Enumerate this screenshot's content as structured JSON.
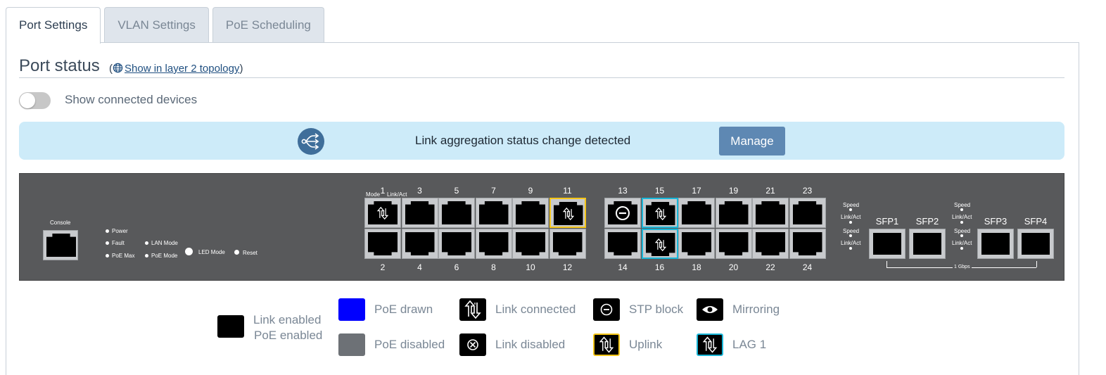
{
  "tabs": [
    {
      "label": "Port Settings",
      "active": true
    },
    {
      "label": "VLAN Settings",
      "active": false
    },
    {
      "label": "PoE Scheduling",
      "active": false
    }
  ],
  "port_status": {
    "title": "Port status",
    "topology_link": "Show in layer 2 topology",
    "topology_open": "(",
    "topology_close": ")"
  },
  "toggle": {
    "label": "Show connected devices",
    "on": false
  },
  "alert": {
    "message": "Link aggregation status change detected",
    "button": "Manage",
    "icon": "link-aggregation-icon"
  },
  "switch_panel": {
    "console_label": "Console",
    "leds": {
      "power": "Power",
      "fault": "Fault",
      "poe_max": "PoE Max",
      "lan_mode": "LAN Mode",
      "poe_mode": "PoE Mode",
      "led_mode": "LED Mode",
      "reset": "Reset"
    },
    "mode_label": "Mode",
    "link_act_label": "Link/Act",
    "top_ports": [
      "1",
      "3",
      "5",
      "7",
      "9",
      "11",
      "13",
      "15",
      "17",
      "19",
      "21",
      "23"
    ],
    "bottom_ports": [
      "2",
      "4",
      "6",
      "8",
      "10",
      "12",
      "14",
      "16",
      "18",
      "20",
      "22",
      "24"
    ],
    "port_states": {
      "1": "link-connected",
      "11": "uplink",
      "13": "stp-block",
      "15": "lag",
      "16": "lag"
    },
    "sfp_leds": {
      "speed": "Speed",
      "link_act": "Link/Act"
    },
    "sfp_ports": [
      "SFP1",
      "SFP2",
      "SFP3",
      "SFP4"
    ],
    "sfp_speed": "1 Gbps"
  },
  "legend": {
    "link_enabled": "Link enabled",
    "poe_enabled": "PoE enabled",
    "poe_drawn": "PoE drawn",
    "poe_disabled": "PoE disabled",
    "link_connected": "Link connected",
    "link_disabled": "Link disabled",
    "stp_block": "STP block",
    "uplink": "Uplink",
    "mirroring": "Mirroring",
    "lag1": "LAG 1"
  },
  "colors": {
    "poe_drawn": "#0000ff",
    "poe_disabled": "#6d7176",
    "uplink": "#f5c518",
    "lag": "#19b6d8",
    "accent": "#5e88b3"
  }
}
